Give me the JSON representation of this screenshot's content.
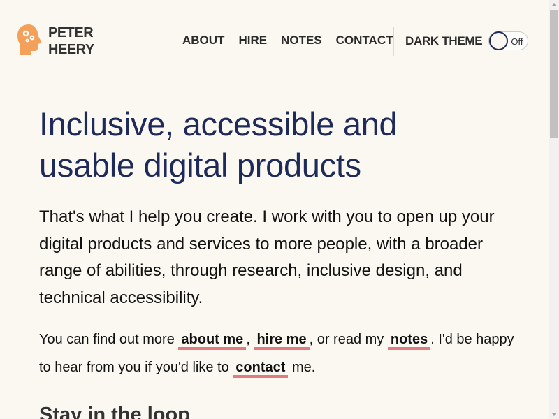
{
  "header": {
    "logo": {
      "line1": "PETER",
      "line2": "HEERY",
      "icon": "head-with-gears-icon",
      "color": "#f2a05a"
    },
    "nav": [
      {
        "label": "ABOUT"
      },
      {
        "label": "HIRE"
      },
      {
        "label": "NOTES"
      },
      {
        "label": "CONTACT"
      }
    ],
    "theme_toggle": {
      "label": "DARK THEME",
      "state": "Off"
    }
  },
  "main": {
    "title_line1": "Inclusive, accessible and",
    "title_line2": "usable digital products",
    "lead": "That's what I help you create. I work with you to open up your digital products and services to more people, with a broader range of abilities, through research, inclusive design, and technical accessibility.",
    "body": {
      "t1": "You can find out more ",
      "link_about": "about me",
      "t2": ", ",
      "link_hire": "hire me",
      "t3": ", or read my ",
      "link_notes": "notes",
      "t4": ". I'd be happy to hear from you if you'd like to ",
      "link_contact": "contact",
      "t5": " me."
    },
    "section_heading": "Stay in the loop"
  },
  "colors": {
    "background": "#fbf8f2",
    "title": "#1e2a5a",
    "link_underline": "#e27a7f",
    "logo": "#f2a05a"
  }
}
